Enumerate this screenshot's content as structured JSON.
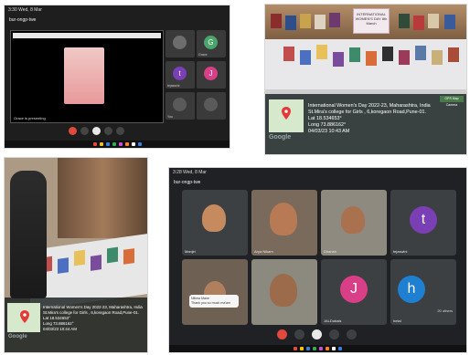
{
  "meet_top": {
    "status_time": "3:30 Wed, 8 Mar",
    "meeting_code": "bur-ongp-twe",
    "share_label": "Grace is presenting",
    "tiles": [
      {
        "initial": "",
        "name": "",
        "color": "#6d6d6d"
      },
      {
        "initial": "G",
        "name": "Grace",
        "color": "#4aa56b"
      },
      {
        "initial": "t",
        "name": "tejaswini",
        "color": "#7b3fb5"
      },
      {
        "initial": "J",
        "name": "",
        "color": "#d93f87"
      },
      {
        "initial": "",
        "name": "You",
        "color": "#5a5a5a"
      },
      {
        "initial": "",
        "name": "",
        "color": "#5a5a5a"
      }
    ]
  },
  "exhibit": {
    "banner_text": "INTERNATIONAL WOMEN'S DAY 8th March",
    "gps_badge": "GPS Map Camera",
    "lines": [
      "International Women's Day 2022-23, Maharashtra, India",
      "St.Mira's college for Girls , 6,koregaon Road,Pune-01.",
      "Lat 18.534653°",
      "Long 73.886162°",
      "04/03/23 10:43 AM"
    ],
    "google": "Google"
  },
  "library": {
    "lines": [
      "International Women's Day 2022-23, Maharashtra, India",
      "St.Mira's college for Girls , 6,koregaon Road,Pune-01.",
      "Lat 18.534653°",
      "Long 73.886162°",
      "04/03/23 10:44 AM"
    ],
    "google": "Google"
  },
  "meet_bottom": {
    "status_time": "3:28 Wed, 8 Mar",
    "meeting_code": "bur-ongp-twe",
    "tiles": [
      {
        "name": "Manjiri"
      },
      {
        "name": "Arya Nikam"
      },
      {
        "name": "Dhansh"
      },
      {
        "initial": "t",
        "name": "tejaswini",
        "color": "#7b3fb5"
      },
      {
        "name": ""
      },
      {
        "name": ""
      },
      {
        "initial": "J",
        "name": "JALDubals",
        "color": "#d93f87"
      },
      {
        "initial": "h",
        "name": "hetal",
        "color": "#1f7fd1"
      }
    ],
    "chat_name": "Nilima Mane",
    "chat_msg": "Thank you so much ma'am",
    "others": "20 others"
  }
}
